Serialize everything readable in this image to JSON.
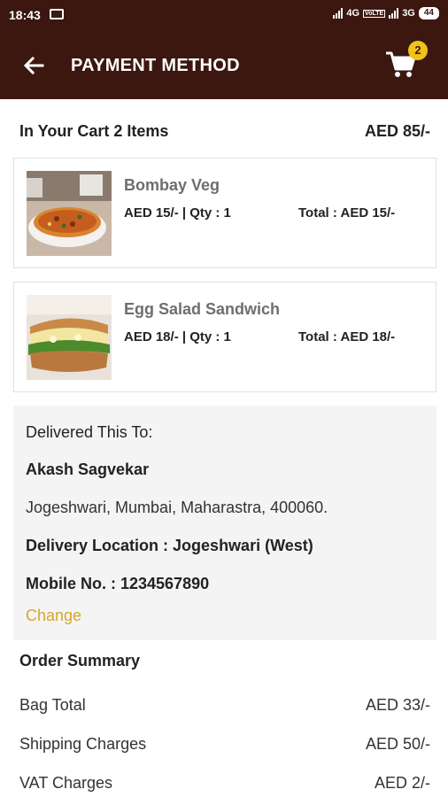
{
  "status_bar": {
    "time": "18:43",
    "network1": "4G",
    "volte": "VoLTE",
    "network2": "3G",
    "battery": "44"
  },
  "app_bar": {
    "title": "PAYMENT METHOD",
    "cart_count": "2",
    "icons": [
      "back-arrow-icon",
      "shopping-cart-icon"
    ],
    "background": "#3b1710",
    "badge_color": "#f2c21b"
  },
  "cart": {
    "heading": "In Your Cart 2 Items",
    "total": "AED 85/-"
  },
  "items": [
    {
      "name": "Bombay Veg",
      "price_qty": "AED 15/-  |  Qty : 1",
      "total": "Total : AED 15/-",
      "image": "pizza-thumbnail"
    },
    {
      "name": "Egg Salad Sandwich",
      "price_qty": "AED 18/-  |  Qty : 1",
      "total": "Total : AED 18/-",
      "image": "sandwich-thumbnail"
    }
  ],
  "delivery": {
    "label": "Delivered This To:",
    "name": "Akash Sagvekar",
    "address": "Jogeshwari, Mumbai, Maharastra, 400060.",
    "location": "Delivery Location : Jogeshwari (West)",
    "mobile": "Mobile No. : 1234567890",
    "change_label": "Change",
    "change_color": "#d4a72c"
  },
  "order_summary": {
    "title": "Order Summary",
    "rows": [
      {
        "label": "Bag Total",
        "value": "AED 33/-"
      },
      {
        "label": "Shipping Charges",
        "value": "AED 50/-"
      },
      {
        "label": "VAT Charges",
        "value": "AED 2/-"
      }
    ]
  }
}
